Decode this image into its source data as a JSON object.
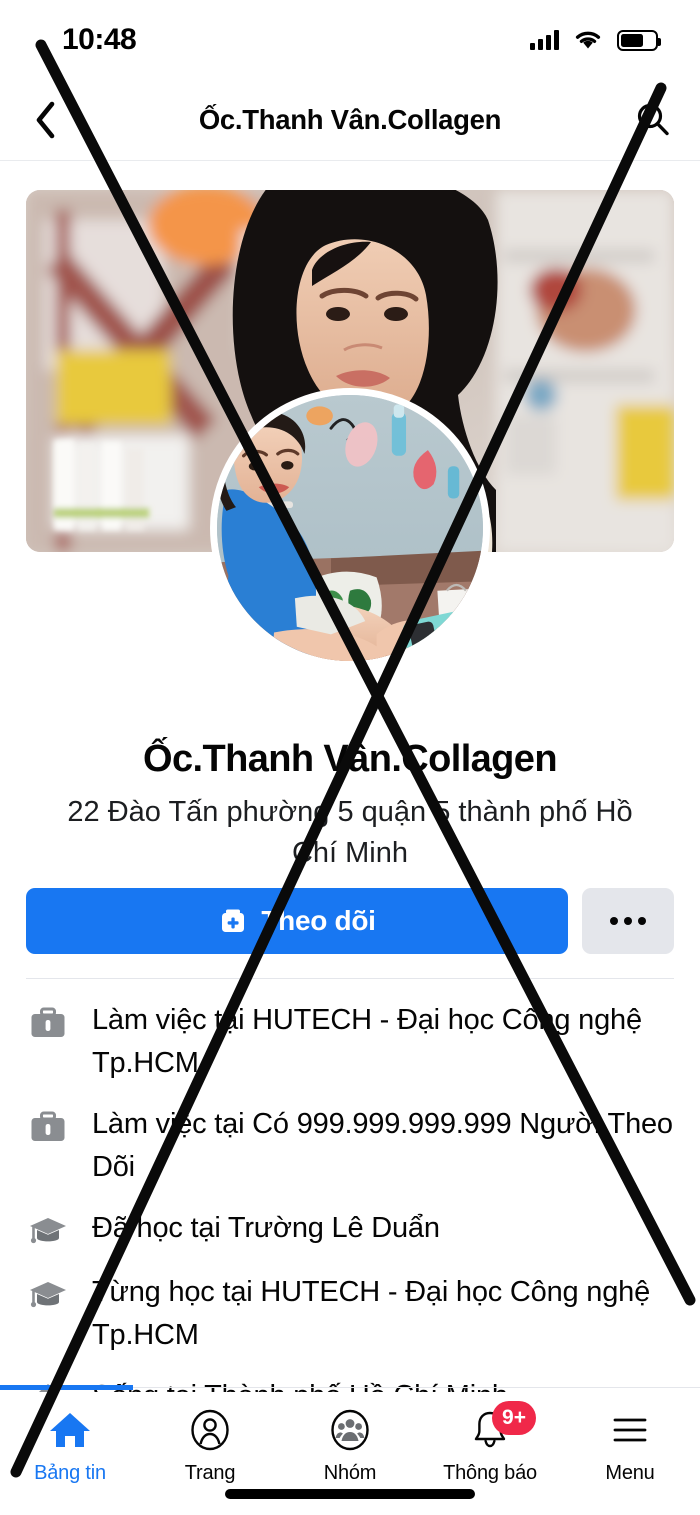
{
  "status_bar": {
    "time": "10:48",
    "signal_icon": "cellular-signal-icon",
    "wifi_icon": "wifi-icon",
    "battery_icon": "battery-icon"
  },
  "header": {
    "back_icon": "chevron-left-icon",
    "title": "Ốc.Thanh Vân.Collagen",
    "search_icon": "search-icon"
  },
  "profile": {
    "cover_photo_alt": "cover-photo",
    "avatar_alt": "profile-avatar",
    "name": "Ốc.Thanh Vân.Collagen",
    "address": "22 Đào Tấn phường 5 quận 5 thành phố Hồ Chí Minh"
  },
  "actions": {
    "follow_label": "Theo dõi",
    "follow_icon": "follow-plus-icon",
    "follow_color": "#1877f2",
    "more_icon": "more-dots-icon",
    "more_color": "#e4e6eb"
  },
  "info_items": [
    {
      "icon": "briefcase-icon",
      "text": "Làm việc tại HUTECH - Đại học Công nghệ Tp.HCM"
    },
    {
      "icon": "briefcase-icon",
      "text": "Làm việc tại Có 999.999.999.999 Người Theo Dõi"
    },
    {
      "icon": "graduation-cap-icon",
      "text": "Đã học tại Trường Lê Duẩn"
    },
    {
      "icon": "graduation-cap-icon",
      "text": "Từng học tại HUTECH - Đại học Công nghệ Tp.HCM"
    },
    {
      "icon": "home-icon",
      "text": "Sống tại Thành phố Hồ Chí Minh"
    }
  ],
  "bottom_nav": {
    "active_color": "#1877f2",
    "badge_color": "#f02849",
    "items": [
      {
        "icon": "home-icon",
        "label": "Bảng tin",
        "active": true,
        "badge": ""
      },
      {
        "icon": "pages-profile-icon",
        "label": "Trang",
        "active": false,
        "badge": ""
      },
      {
        "icon": "groups-icon",
        "label": "Nhóm",
        "active": false,
        "badge": ""
      },
      {
        "icon": "bell-icon",
        "label": "Thông báo",
        "active": false,
        "badge": "9+"
      },
      {
        "icon": "hamburger-menu-icon",
        "label": "Menu",
        "active": false,
        "badge": ""
      }
    ]
  },
  "overlay": {
    "type": "black-x-cross-annotation",
    "color": "#0a0a0a"
  }
}
